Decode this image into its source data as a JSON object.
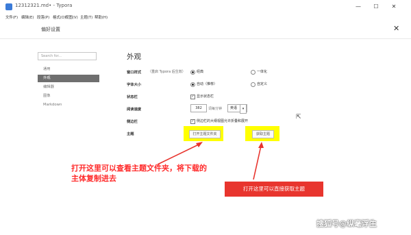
{
  "window": {
    "title": "12312321.md• - Typora",
    "minimize_label": "—",
    "maximize_label": "☐",
    "close_label": "✕"
  },
  "menubar": {
    "items": [
      "文件(F)",
      "编辑(E)",
      "段落(P)",
      "格式(O)",
      "视图(V)",
      "主题(T)",
      "帮助(H)"
    ]
  },
  "preferences": {
    "title": "偏好设置",
    "close_label": "✕",
    "search_placeholder": "Search for...",
    "sidebar": [
      "通用",
      "外观",
      "编辑器",
      "图像",
      "Markdown"
    ],
    "active_sidebar_index": 1,
    "section_title": "外观",
    "window_style": {
      "label": "窗口样式",
      "note": "（重启 Typora 后生效）",
      "options": [
        "经典",
        "一体化"
      ],
      "selected": "经典"
    },
    "font_size": {
      "label": "字体大小",
      "options": [
        "自动（推荐）",
        "自定义"
      ],
      "selected": "自动（推荐）"
    },
    "status_bar": {
      "label": "状态栏",
      "checkbox_label": "显示状态栏",
      "checked": true
    },
    "reading_speed": {
      "label": "阅读速度",
      "value": "382",
      "unit": "词每分钟",
      "select_value": "英语"
    },
    "sidebar_option": {
      "label": "侧边栏",
      "checkbox_label": "侧边栏的大纲视图允许折叠和展开",
      "checked": true
    },
    "theme": {
      "label": "主题",
      "open_folder_button": "打开主题文件夹",
      "get_themes_button": "获取主题"
    }
  },
  "annotations": {
    "left_note": "打开这里可以查看主题文件夹，将下载的主体复制进去",
    "right_note": "打开这里可以直接获取主题",
    "color": "#ff2a2a"
  },
  "watermark": "搜狐号@纵毫浮生"
}
